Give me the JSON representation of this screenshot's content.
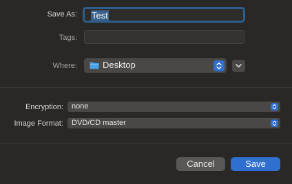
{
  "save_as": {
    "label": "Save As:",
    "value": "Test"
  },
  "tags": {
    "label": "Tags:",
    "value": ""
  },
  "where": {
    "label": "Where:",
    "value": "Desktop",
    "icon": "folder-icon"
  },
  "encryption": {
    "label": "Encryption:",
    "value": "none"
  },
  "image_format": {
    "label": "Image Format:",
    "value": "DVD/CD master"
  },
  "buttons": {
    "cancel": "Cancel",
    "save": "Save"
  },
  "colors": {
    "accent": "#2f6fd0",
    "background": "#2a2827",
    "folder": "#4aa3e6"
  }
}
